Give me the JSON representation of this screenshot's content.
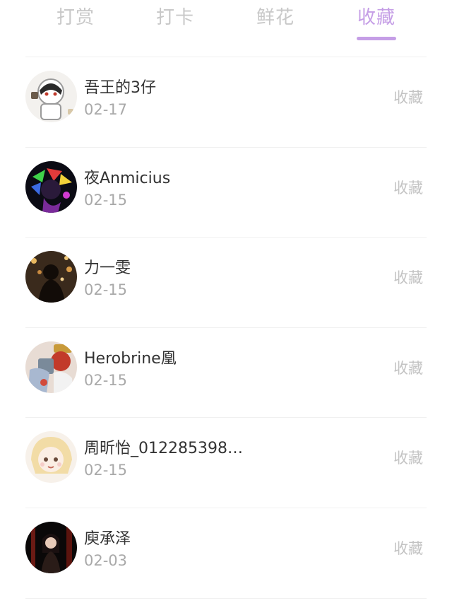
{
  "tabs": [
    {
      "label": "打赏"
    },
    {
      "label": "打卡"
    },
    {
      "label": "鲜花"
    },
    {
      "label": "收藏"
    }
  ],
  "active_tab": "收藏",
  "accent_color": "#c59ee6",
  "items": [
    {
      "name": "吾王的3仔",
      "date": "02-17",
      "action": "收藏"
    },
    {
      "name": "夜Anmicius",
      "date": "02-15",
      "action": "收藏"
    },
    {
      "name": "力一雯",
      "date": "02-15",
      "action": "收藏"
    },
    {
      "name": "Herobrine凰",
      "date": "02-15",
      "action": "收藏"
    },
    {
      "name": "周昕怡_012285398…",
      "date": "02-15",
      "action": "收藏"
    },
    {
      "name": "庾承泽",
      "date": "02-03",
      "action": "收藏"
    }
  ]
}
